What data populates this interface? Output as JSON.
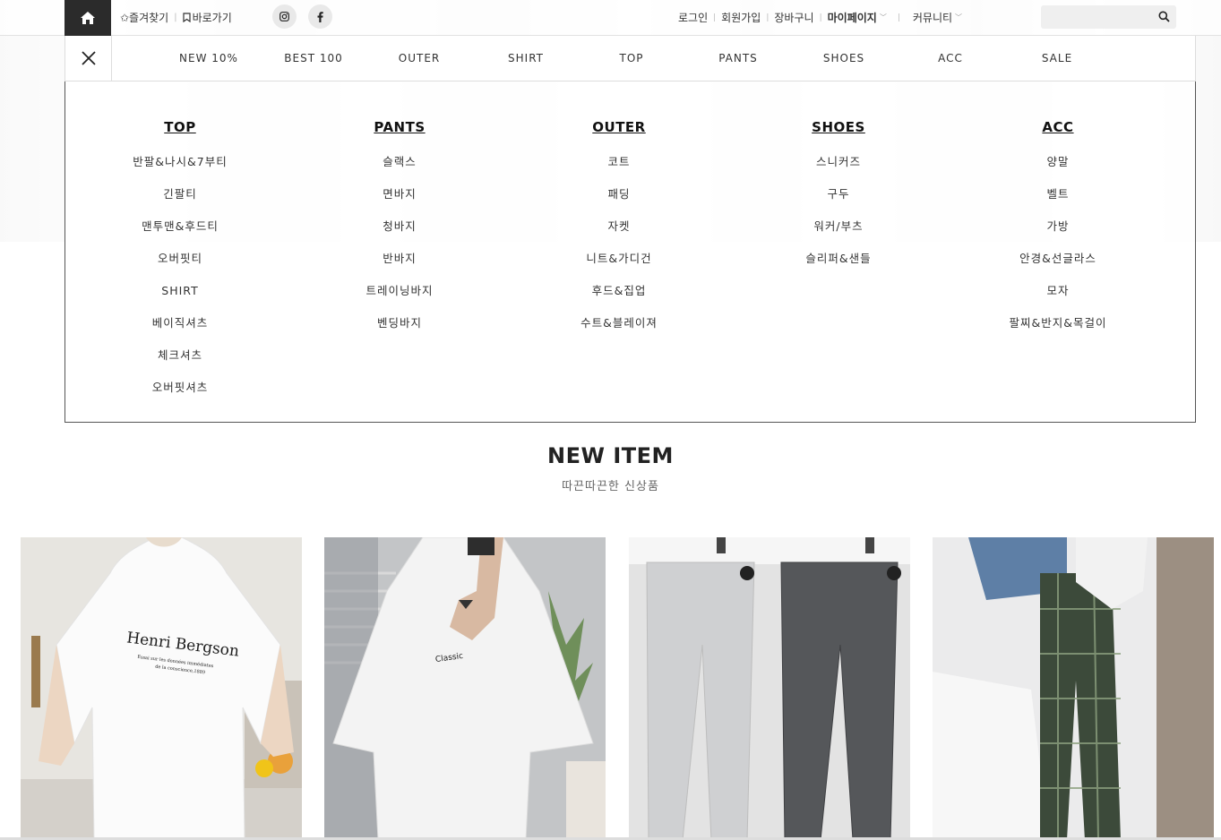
{
  "topbar": {
    "favorites": "✩즐겨찾기",
    "shortcut": "바로가기",
    "login": "로그인",
    "join": "회원가입",
    "cart": "장바구니",
    "mypage": "마이페이지",
    "community": "커뮤니티",
    "search_placeholder": ""
  },
  "nav": {
    "items": [
      "NEW 10%",
      "BEST 100",
      "OUTER",
      "SHIRT",
      "TOP",
      "PANTS",
      "SHOES",
      "ACC",
      "SALE"
    ]
  },
  "mega": {
    "columns": [
      {
        "title": "TOP",
        "items": [
          "반팔&나시&7부티",
          "긴팔티",
          "맨투맨&후드티",
          "오버핏티",
          "SHIRT",
          "베이직셔츠",
          "체크셔츠",
          "오버핏셔츠"
        ]
      },
      {
        "title": "PANTS",
        "items": [
          "슬랙스",
          "면바지",
          "청바지",
          "반바지",
          "트레이닝바지",
          "벤딩바지"
        ]
      },
      {
        "title": "OUTER",
        "items": [
          "코트",
          "패딩",
          "자켓",
          "니트&가디건",
          "후드&집업",
          "수트&블레이져"
        ]
      },
      {
        "title": "SHOES",
        "items": [
          "스니커즈",
          "구두",
          "워커/부츠",
          "슬리퍼&샌들"
        ]
      },
      {
        "title": "ACC",
        "items": [
          "양말",
          "벨트",
          "가방",
          "안경&선글라스",
          "모자",
          "팔찌&반지&목걸이"
        ]
      }
    ]
  },
  "section": {
    "title": "NEW ITEM",
    "subtitle": "따끈따끈한 신상품"
  },
  "products": [
    {
      "print_main": "Henri Bergson",
      "print_sub1": "Essai sur les données immédiates",
      "print_sub2": "de la conscience,1889"
    },
    {
      "print_main": "Classic"
    },
    {},
    {}
  ],
  "colors": {
    "accent_dark": "#2b2b2b",
    "border": "#dddddd"
  }
}
